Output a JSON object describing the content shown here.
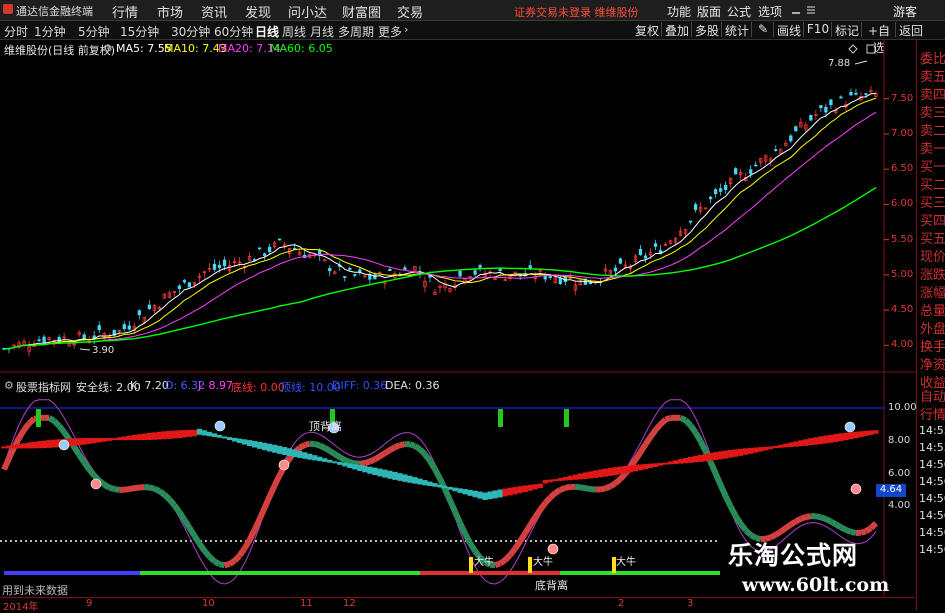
{
  "menubar": {
    "app_title": "通达信金融终端",
    "items": [
      "行情",
      "市场",
      "资讯",
      "发现",
      "问小达",
      "财富圈",
      "交易"
    ],
    "warning": "证券交易未登录 维维股份",
    "right_items": [
      "功能",
      "版面",
      "公式",
      "选项"
    ],
    "guest": "游客"
  },
  "toolbar": {
    "periods": [
      "分时",
      "1分钟",
      "5分钟",
      "15分钟",
      "30分钟",
      "60分钟",
      "日线",
      "周线",
      "月线",
      "多周期",
      "更多"
    ],
    "active_period": "日线",
    "buttons": [
      "复权",
      "叠加",
      "多股",
      "统计",
      "画线",
      "F10",
      "标记",
      "+自选",
      "返回"
    ]
  },
  "main_legend": {
    "title": "维维股份(日线 前复权)",
    "ma": [
      {
        "label": "MA5: 7.55",
        "color": "#ffffff"
      },
      {
        "label": "MA10: 7.43",
        "color": "#ffff00"
      },
      {
        "label": "MA20: 7.14",
        "color": "#ff40ff"
      },
      {
        "label": "MA60: 6.05",
        "color": "#00ff00"
      }
    ]
  },
  "sub_legend": {
    "title": "股票指标网",
    "items": [
      {
        "label": "安全线: 2.00",
        "color": "#e0e0e0"
      },
      {
        "label": "K: 7.20",
        "color": "#e0e0e0"
      },
      {
        "label": "D: 6.32",
        "color": "#4060ff"
      },
      {
        "label": "J: 8.97",
        "color": "#ff40ff"
      },
      {
        "label": "底线: 0.00",
        "color": "#ff3030"
      },
      {
        "label": "顶线: 10.00",
        "color": "#3050ff"
      },
      {
        "label": "DIFF: 0.36",
        "color": "#3050ff"
      },
      {
        "label": "DEA: 0.36",
        "color": "#e0e0e0"
      }
    ]
  },
  "right_panel": {
    "quote_labels": [
      "委比",
      "卖五",
      "卖四",
      "卖三",
      "卖二",
      "卖一",
      "买一",
      "买二",
      "买三",
      "买四",
      "买五",
      "现价",
      "涨跌",
      "涨幅",
      "总量",
      "外盘",
      "换手",
      "净资",
      "收益"
    ],
    "lower_labels": [
      "自动",
      "行情"
    ],
    "lower_times": [
      "14:55",
      "14:55",
      "14:56",
      "14:56",
      "14:56",
      "14:56",
      "14:56",
      "14:56"
    ]
  },
  "chart_data": {
    "type": "candlestick",
    "title": "维维股份(日线 前复权)",
    "price_axis": {
      "ticks": [
        4.0,
        4.5,
        5.0,
        5.5,
        6.0,
        6.5,
        7.0,
        7.5
      ],
      "range": [
        3.65,
        8.05
      ]
    },
    "indicator_axis": {
      "ticks": [
        4.0,
        6.0,
        8.0,
        10.0
      ],
      "current_value": "4.64"
    },
    "annotations": {
      "high": "7.88",
      "low": "3.90"
    },
    "ma_values": {
      "MA5": 7.55,
      "MA10": 7.43,
      "MA20": 7.14,
      "MA60": 6.05
    },
    "dates": {
      "year": "2014年",
      "months": [
        "9",
        "10",
        "11",
        "12",
        "2",
        "3"
      ]
    },
    "indicator_labels": {
      "top": "顶背离",
      "bottom": "底背离",
      "bull": "大牛"
    },
    "footnote": "用到未来数据"
  },
  "watermark": {
    "cn": "乐淘公式网",
    "url": "www.60lt.com"
  }
}
